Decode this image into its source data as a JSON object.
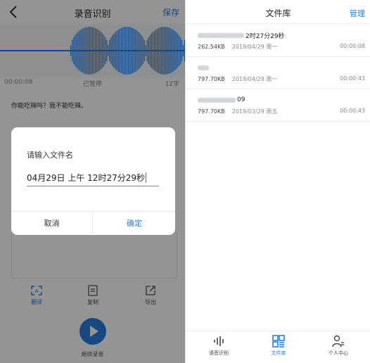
{
  "left": {
    "header": {
      "title": "录音识别",
      "save_label": "保存"
    },
    "info": {
      "elapsed": "00:00:08",
      "status": "已暂停",
      "char_count": "12字"
    },
    "transcript": "你能吃辣吗？我不能吃辣。",
    "tools": [
      {
        "label": "翻译",
        "icon": "translate-icon"
      },
      {
        "label": "复制",
        "icon": "copy-icon"
      },
      {
        "label": "导出",
        "icon": "export-icon"
      }
    ],
    "continue_label": "继续录音",
    "dialog": {
      "title": "请输入文件名",
      "value": "04月29日 上午 12时27分29秒",
      "cancel_label": "取消",
      "ok_label": "确定"
    }
  },
  "right": {
    "header": {
      "title": "文件库",
      "manage_label": "管理"
    },
    "files": [
      {
        "name_visible": "2时27分29秒",
        "size": "262.54KB",
        "date": "2019/04/29 周一",
        "duration": "00:00:08"
      },
      {
        "name_visible": "",
        "size": "797.70KB",
        "date": "2019/04/29 周一",
        "duration": "00:00:43"
      },
      {
        "name_visible": "09",
        "size": "797.70KB",
        "date": "2019/03/29 周五",
        "duration": "00:00:43"
      }
    ],
    "tabs": [
      {
        "label": "语音识别",
        "icon": "waveform-icon"
      },
      {
        "label": "文件库",
        "icon": "grid-list-icon"
      },
      {
        "label": "个人中心",
        "icon": "person-icon"
      }
    ]
  },
  "colors": {
    "accent": "#2a7de1",
    "caret": "#e23b3b"
  }
}
